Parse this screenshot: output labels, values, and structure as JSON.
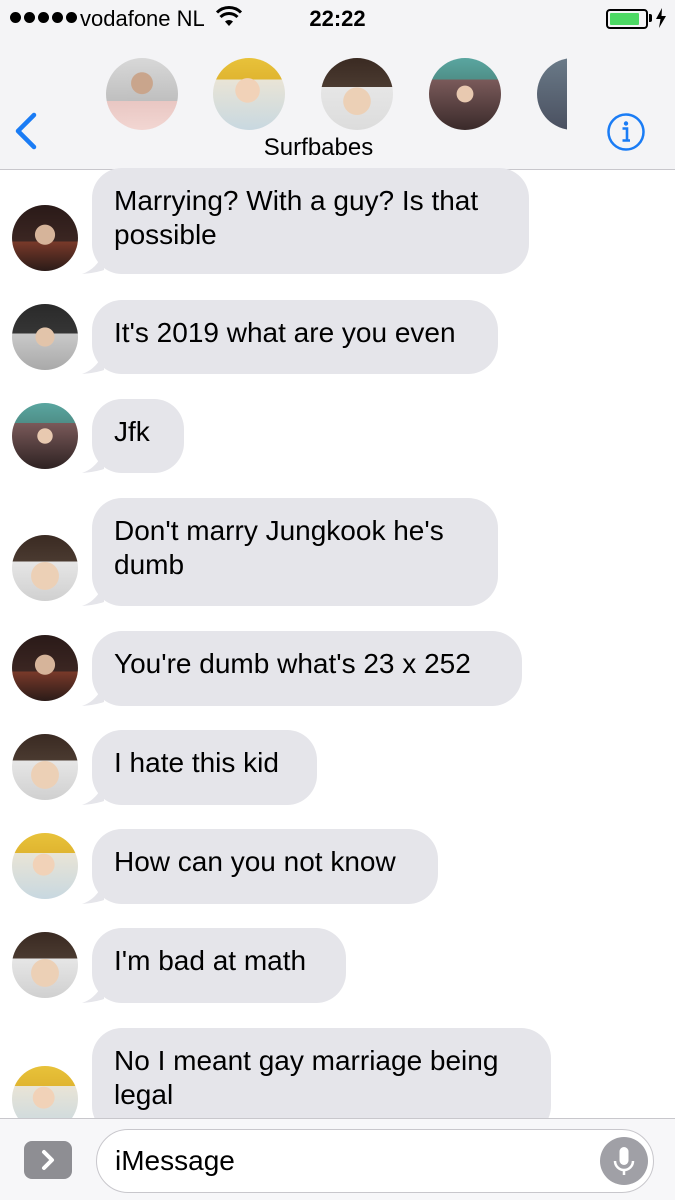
{
  "status_bar": {
    "carrier": "vodafone NL",
    "time": "22:22",
    "battery_level": 0.85
  },
  "header": {
    "group_name": "Surfbabes",
    "participant_count_visible": 5
  },
  "messages": [
    {
      "text_line1": "Marrying? With a guy? Is that",
      "text_line2": "possible"
    },
    {
      "text_line1": "It's 2019 what are you even"
    },
    {
      "text_line1": "Jfk"
    },
    {
      "text_line1": "Don't marry Jungkook he's",
      "text_line2": "dumb"
    },
    {
      "text_line1": "You're dumb what's 23 x 252"
    },
    {
      "text_line1": "I hate this kid"
    },
    {
      "text_line1": "How can you not know"
    },
    {
      "text_line1": "I'm bad at math"
    },
    {
      "text_line1": "No I meant gay marriage being",
      "text_line2": "legal"
    }
  ],
  "input": {
    "placeholder": "iMessage"
  },
  "colors": {
    "accent": "#1a7cf5",
    "bubble": "#e5e5ea",
    "bar": "#f4f4f6",
    "battery": "#4cd964"
  },
  "icons": [
    "back-chevron-icon",
    "info-icon",
    "app-drawer-icon",
    "microphone-icon",
    "wifi-icon",
    "charging-bolt-icon"
  ]
}
